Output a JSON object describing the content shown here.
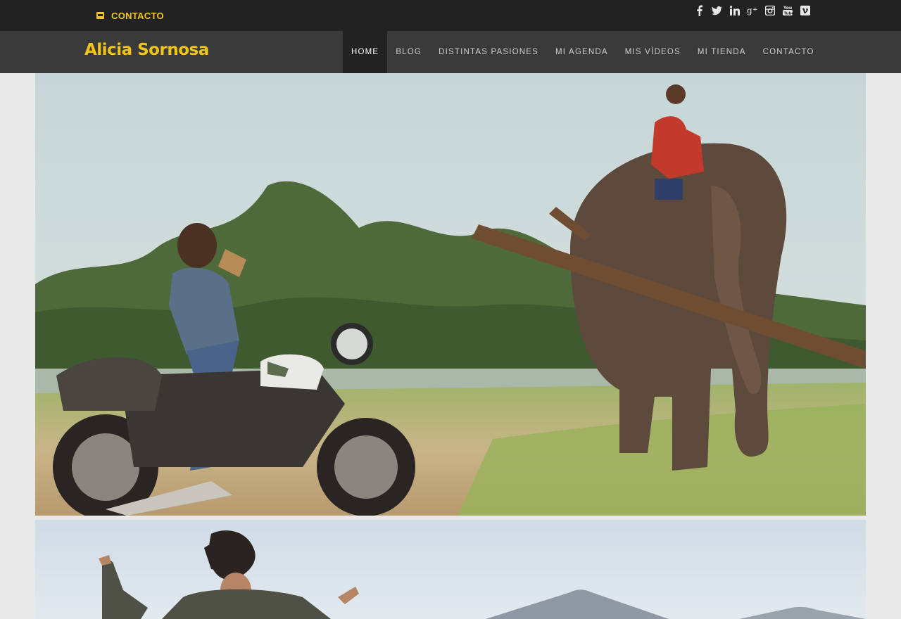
{
  "topbar": {
    "contact_label": "CONTACTO",
    "contact_icon": "envelope-icon",
    "socials": [
      "facebook-icon",
      "twitter-icon",
      "linkedin-icon",
      "google-plus-icon",
      "instagram-icon",
      "youtube-icon",
      "vimeo-icon"
    ]
  },
  "brand": {
    "name": "Alicia Sornosa"
  },
  "nav": {
    "items": [
      {
        "label": "HOME"
      },
      {
        "label": "BLOG"
      },
      {
        "label": "DISTINTAS PASIONES"
      },
      {
        "label": "MI AGENDA"
      },
      {
        "label": "MIS VÍDEOS"
      },
      {
        "label": "MI TIENDA"
      },
      {
        "label": "CONTACTO"
      }
    ],
    "active_index": 0
  },
  "colors": {
    "accent": "#f0c419",
    "topbar_bg": "#222222",
    "navbar_bg": "#3a3a3a",
    "page_bg": "#e9e9e9"
  }
}
